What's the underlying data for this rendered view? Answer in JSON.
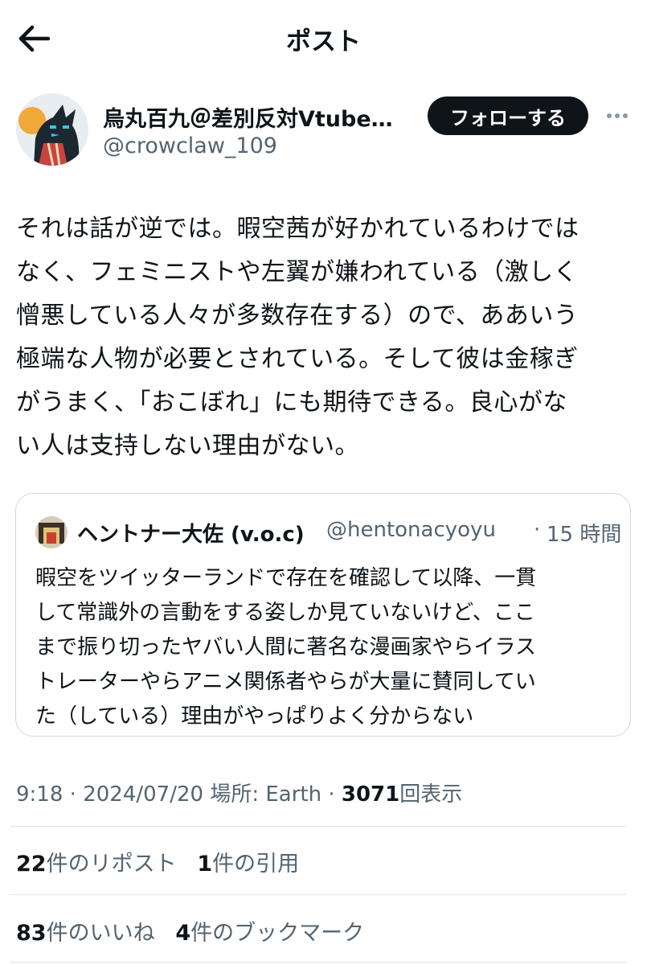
{
  "header": {
    "title": "ポスト",
    "back_icon": "arrow-left-icon"
  },
  "author": {
    "display_name": "烏丸百九＠差別反対Vtube…",
    "handle": "@crowclaw_109",
    "follow_label": "フォローする",
    "more_icon": "more-dots-icon"
  },
  "tweet": {
    "text": "それは話が逆では。暇空茜が好かれているわけでは\nなく、フェミニストや左翼が嫌われている（激しく\n憎悪している人々が多数存在する）ので、ああいう\n極端な人物が必要とされている。そして彼は金稼ぎ\nがうまく、「おこぼれ」にも期待できる。良心がな\nい人は支持しない理由がない。"
  },
  "quote": {
    "name": "ヘントナー大佐 (v.o.c)",
    "handle": "@hentonacyoyu",
    "separator": "·",
    "time": "15 時間",
    "text": "暇空をツイッターランドで存在を確認して以降、一貫\nして常識外の言動をする姿しか見ていないけど、ここ\nまで振り切ったヤバい人間に著名な漫画家やらイラス\nトレーターやらアニメ関係者やらが大量に賛同してい\nた（している）理由がやっぱりよく分からない"
  },
  "meta": {
    "time": "9:18",
    "sep1": "·",
    "date": "2024/07/20",
    "location": "場所: Earth",
    "sep2": "·",
    "views_count": "3071",
    "views_label": "回表示"
  },
  "stats": {
    "reposts_count": "22",
    "reposts_label": "件のリポスト",
    "quotes_count": "1",
    "quotes_label": "件の引用",
    "likes_count": "83",
    "likes_label": "件のいいね",
    "bookmarks_count": "4",
    "bookmarks_label": "件のブックマーク"
  },
  "colors": {
    "text": "#0f1419",
    "secondary": "#536471",
    "border": "#cfd9de",
    "button_bg": "#0f1419"
  }
}
